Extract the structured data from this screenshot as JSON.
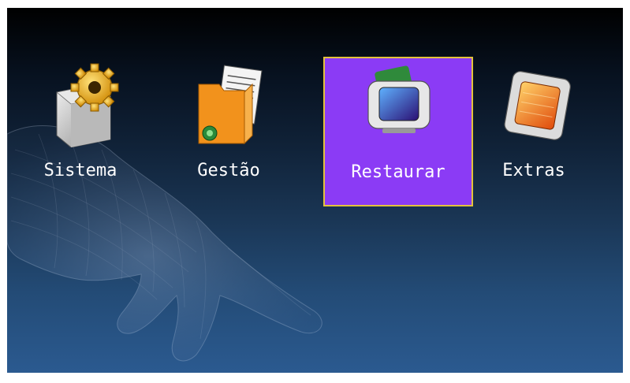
{
  "menu": {
    "items": [
      {
        "label": "Sistema",
        "icon": "system-settings-icon",
        "selected": false
      },
      {
        "label": "Gestão",
        "icon": "management-folder-icon",
        "selected": false
      },
      {
        "label": "Restaurar",
        "icon": "restore-device-icon",
        "selected": true
      },
      {
        "label": "Extras",
        "icon": "extras-card-icon",
        "selected": false
      }
    ]
  },
  "colors": {
    "selection_fill": "#8b3bf5",
    "selection_border": "#e3c23d",
    "label_text": "#ffffff"
  }
}
